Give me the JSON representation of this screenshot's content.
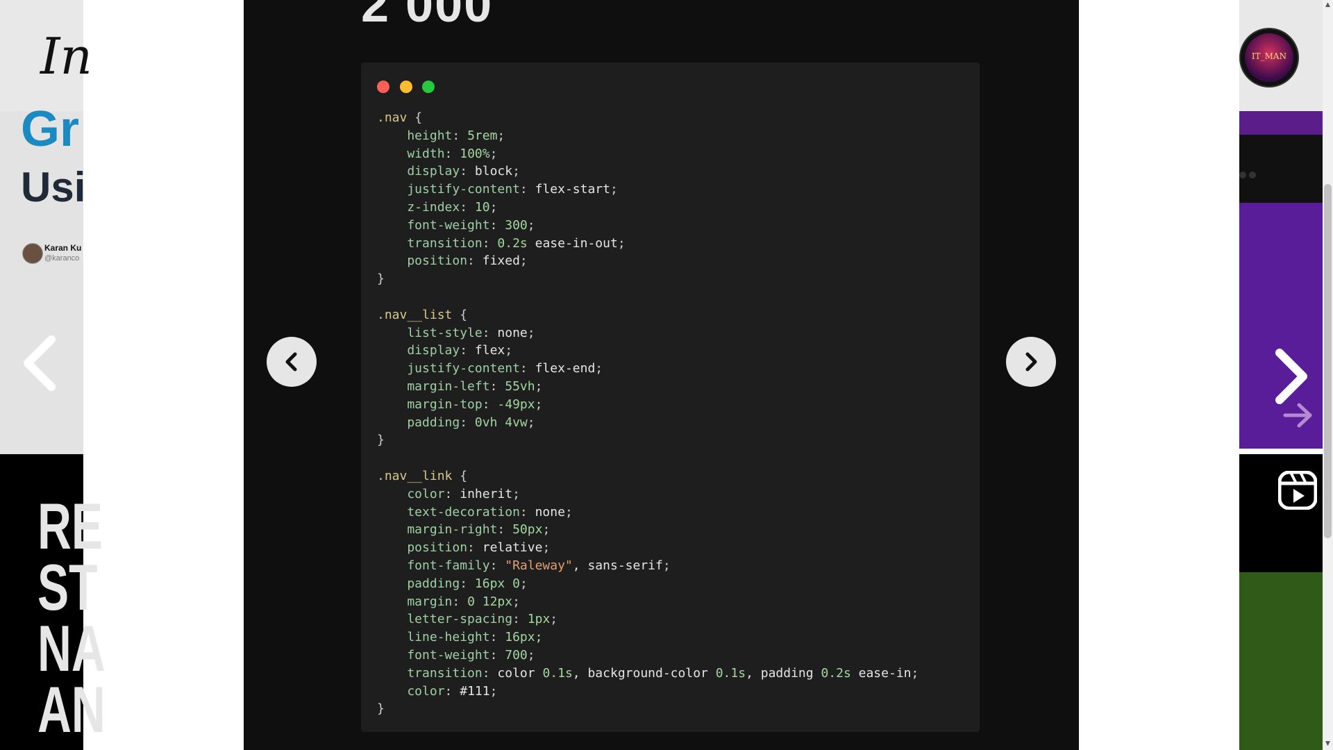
{
  "modal": {
    "title_partial": "2 000",
    "code_lines": [
      [
        {
          "t": ".nav",
          "c": "sel"
        },
        {
          "t": " {",
          "c": "punc"
        }
      ],
      [
        {
          "t": "    height",
          "c": "prop"
        },
        {
          "t": ": ",
          "c": "punc"
        },
        {
          "t": "5rem",
          "c": "num"
        },
        {
          "t": ";",
          "c": "punc"
        }
      ],
      [
        {
          "t": "    width",
          "c": "prop"
        },
        {
          "t": ": ",
          "c": "punc"
        },
        {
          "t": "100%",
          "c": "num"
        },
        {
          "t": ";",
          "c": "punc"
        }
      ],
      [
        {
          "t": "    display",
          "c": "prop"
        },
        {
          "t": ": ",
          "c": "punc"
        },
        {
          "t": "block",
          "c": "val"
        },
        {
          "t": ";",
          "c": "punc"
        }
      ],
      [
        {
          "t": "    justify-content",
          "c": "prop"
        },
        {
          "t": ": ",
          "c": "punc"
        },
        {
          "t": "flex-start",
          "c": "val"
        },
        {
          "t": ";",
          "c": "punc"
        }
      ],
      [
        {
          "t": "    z-index",
          "c": "prop"
        },
        {
          "t": ": ",
          "c": "punc"
        },
        {
          "t": "10",
          "c": "num"
        },
        {
          "t": ";",
          "c": "punc"
        }
      ],
      [
        {
          "t": "    font-weight",
          "c": "prop"
        },
        {
          "t": ": ",
          "c": "punc"
        },
        {
          "t": "300",
          "c": "num"
        },
        {
          "t": ";",
          "c": "punc"
        }
      ],
      [
        {
          "t": "    transition",
          "c": "prop"
        },
        {
          "t": ": ",
          "c": "punc"
        },
        {
          "t": "0.2s",
          "c": "num"
        },
        {
          "t": " ease-in-out",
          "c": "val"
        },
        {
          "t": ";",
          "c": "punc"
        }
      ],
      [
        {
          "t": "    position",
          "c": "prop"
        },
        {
          "t": ": ",
          "c": "punc"
        },
        {
          "t": "fixed",
          "c": "val"
        },
        {
          "t": ";",
          "c": "punc"
        }
      ],
      [
        {
          "t": "}",
          "c": "punc"
        }
      ],
      [
        {
          "t": "",
          "c": "punc"
        }
      ],
      [
        {
          "t": ".nav__list",
          "c": "sel"
        },
        {
          "t": " {",
          "c": "punc"
        }
      ],
      [
        {
          "t": "    list-style",
          "c": "prop"
        },
        {
          "t": ": ",
          "c": "punc"
        },
        {
          "t": "none",
          "c": "val"
        },
        {
          "t": ";",
          "c": "punc"
        }
      ],
      [
        {
          "t": "    display",
          "c": "prop"
        },
        {
          "t": ": ",
          "c": "punc"
        },
        {
          "t": "flex",
          "c": "val"
        },
        {
          "t": ";",
          "c": "punc"
        }
      ],
      [
        {
          "t": "    justify-content",
          "c": "prop"
        },
        {
          "t": ": ",
          "c": "punc"
        },
        {
          "t": "flex-end",
          "c": "val"
        },
        {
          "t": ";",
          "c": "punc"
        }
      ],
      [
        {
          "t": "    margin-left",
          "c": "prop"
        },
        {
          "t": ": ",
          "c": "punc"
        },
        {
          "t": "55vh",
          "c": "num"
        },
        {
          "t": ";",
          "c": "punc"
        }
      ],
      [
        {
          "t": "    margin-top",
          "c": "prop"
        },
        {
          "t": ": ",
          "c": "punc"
        },
        {
          "t": "-49px",
          "c": "num"
        },
        {
          "t": ";",
          "c": "punc"
        }
      ],
      [
        {
          "t": "    padding",
          "c": "prop"
        },
        {
          "t": ": ",
          "c": "punc"
        },
        {
          "t": "0vh 4vw",
          "c": "num"
        },
        {
          "t": ";",
          "c": "punc"
        }
      ],
      [
        {
          "t": "}",
          "c": "punc"
        }
      ],
      [
        {
          "t": "",
          "c": "punc"
        }
      ],
      [
        {
          "t": ".nav__link",
          "c": "sel"
        },
        {
          "t": " {",
          "c": "punc"
        }
      ],
      [
        {
          "t": "    color",
          "c": "prop"
        },
        {
          "t": ": ",
          "c": "punc"
        },
        {
          "t": "inherit",
          "c": "val"
        },
        {
          "t": ";",
          "c": "punc"
        }
      ],
      [
        {
          "t": "    text-decoration",
          "c": "prop"
        },
        {
          "t": ": ",
          "c": "punc"
        },
        {
          "t": "none",
          "c": "val"
        },
        {
          "t": ";",
          "c": "punc"
        }
      ],
      [
        {
          "t": "    margin-right",
          "c": "prop"
        },
        {
          "t": ": ",
          "c": "punc"
        },
        {
          "t": "50px",
          "c": "num"
        },
        {
          "t": ";",
          "c": "punc"
        }
      ],
      [
        {
          "t": "    position",
          "c": "prop"
        },
        {
          "t": ": ",
          "c": "punc"
        },
        {
          "t": "relative",
          "c": "val"
        },
        {
          "t": ";",
          "c": "punc"
        }
      ],
      [
        {
          "t": "    font-family",
          "c": "prop"
        },
        {
          "t": ": ",
          "c": "punc"
        },
        {
          "t": "\"Raleway\"",
          "c": "str"
        },
        {
          "t": ", sans-serif",
          "c": "val"
        },
        {
          "t": ";",
          "c": "punc"
        }
      ],
      [
        {
          "t": "    padding",
          "c": "prop"
        },
        {
          "t": ": ",
          "c": "punc"
        },
        {
          "t": "16px 0",
          "c": "num"
        },
        {
          "t": ";",
          "c": "punc"
        }
      ],
      [
        {
          "t": "    margin",
          "c": "prop"
        },
        {
          "t": ": ",
          "c": "punc"
        },
        {
          "t": "0 12px",
          "c": "num"
        },
        {
          "t": ";",
          "c": "punc"
        }
      ],
      [
        {
          "t": "    letter-spacing",
          "c": "prop"
        },
        {
          "t": ": ",
          "c": "punc"
        },
        {
          "t": "1px",
          "c": "num"
        },
        {
          "t": ";",
          "c": "punc"
        }
      ],
      [
        {
          "t": "    line-height",
          "c": "prop"
        },
        {
          "t": ": ",
          "c": "punc"
        },
        {
          "t": "16px",
          "c": "num"
        },
        {
          "t": ";",
          "c": "punc"
        }
      ],
      [
        {
          "t": "    font-weight",
          "c": "prop"
        },
        {
          "t": ": ",
          "c": "punc"
        },
        {
          "t": "700",
          "c": "num"
        },
        {
          "t": ";",
          "c": "punc"
        }
      ],
      [
        {
          "t": "    transition",
          "c": "prop"
        },
        {
          "t": ": ",
          "c": "punc"
        },
        {
          "t": "color ",
          "c": "val"
        },
        {
          "t": "0.1s",
          "c": "num"
        },
        {
          "t": ", background-color ",
          "c": "val"
        },
        {
          "t": "0.1s",
          "c": "num"
        },
        {
          "t": ", padding ",
          "c": "val"
        },
        {
          "t": "0.2s",
          "c": "num"
        },
        {
          "t": " ease-in",
          "c": "val"
        },
        {
          "t": ";",
          "c": "punc"
        }
      ],
      [
        {
          "t": "    color",
          "c": "prop"
        },
        {
          "t": ": ",
          "c": "punc"
        },
        {
          "t": "#111",
          "c": "val"
        },
        {
          "t": ";",
          "c": "punc"
        }
      ],
      [
        {
          "t": "}",
          "c": "punc"
        }
      ]
    ],
    "window_dots": [
      {
        "name": "close",
        "color": "#ff5f56"
      },
      {
        "name": "minimize",
        "color": "#ffbd2e"
      },
      {
        "name": "maximize",
        "color": "#27c93f"
      }
    ]
  },
  "left_page": {
    "logo_partial": "In",
    "title_line1_partial": "Gr",
    "title_line2_partial": "Usi",
    "author_name_partial": "Karan Ku",
    "author_handle_partial": "@karanco",
    "reel_text_lines": [
      "RE",
      "ST",
      "NA",
      "AN"
    ]
  },
  "right_page": {
    "avatar_text": "IT_MAN",
    "reels_icon": "reels-icon"
  },
  "icons": {
    "prev": "chevron-left-icon",
    "next": "chevron-right-icon"
  },
  "colors": {
    "modal_bg": "#0f0f0f",
    "code_bg": "#1e1e1e",
    "left_title": "#1a8ac0"
  }
}
